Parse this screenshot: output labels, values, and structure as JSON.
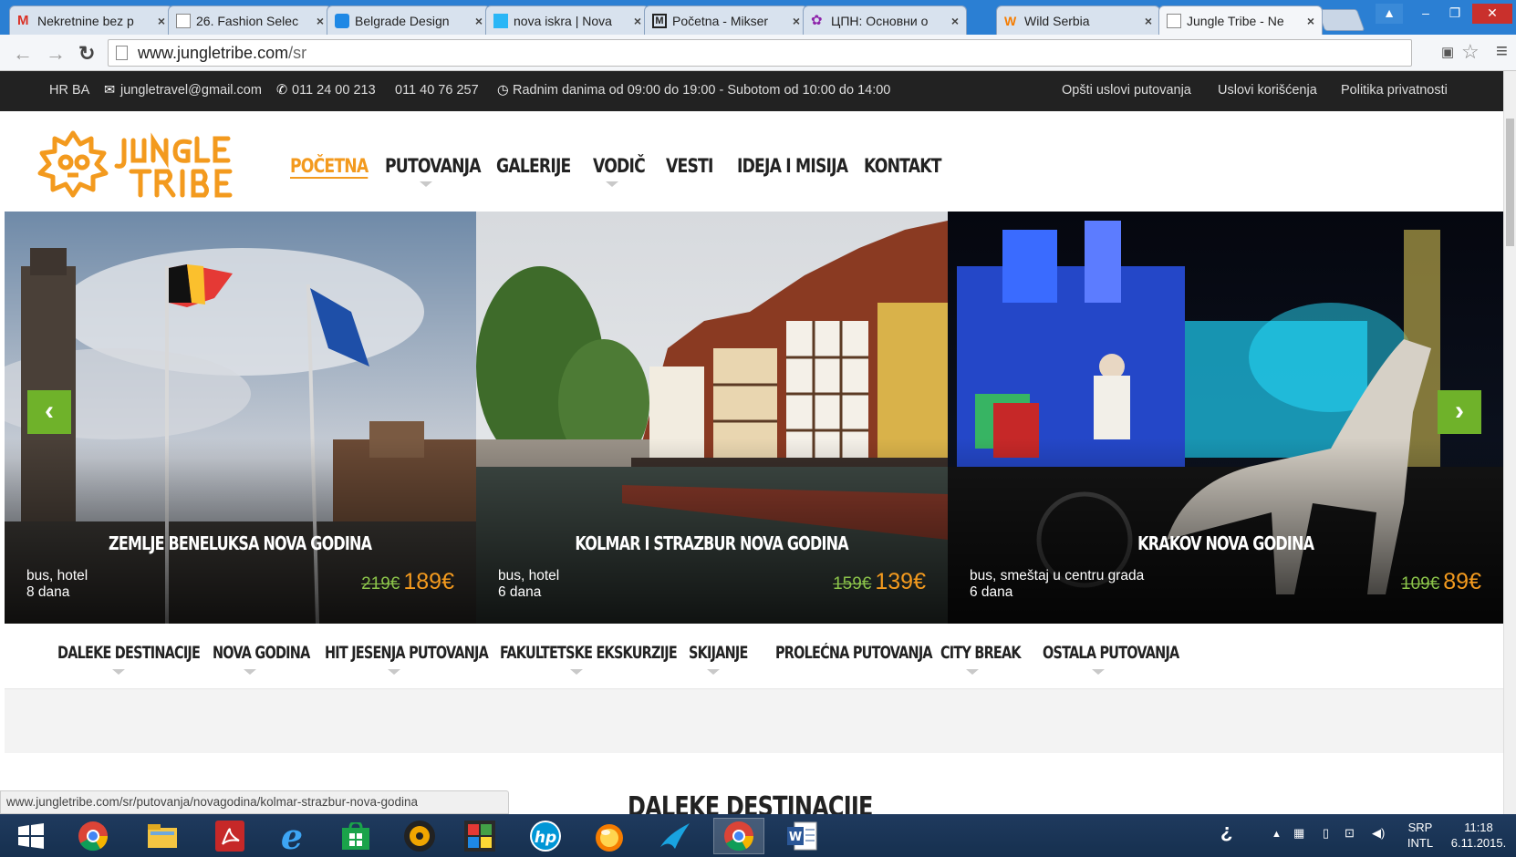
{
  "browser": {
    "tabs": [
      {
        "label": "Nekretnine bez p",
        "icon": "gmail-icon",
        "color": "#d93025"
      },
      {
        "label": "26. Fashion Selec",
        "icon": "page-icon",
        "color": "#888888"
      },
      {
        "label": "Belgrade Design",
        "icon": "bd-icon",
        "color": "#1e88e5"
      },
      {
        "label": "nova iskra | Nova",
        "icon": "iskra-icon",
        "color": "#29b6f6"
      },
      {
        "label": "Početna - Mikser",
        "icon": "mikser-icon",
        "color": "#222222"
      },
      {
        "label": "ЦПН: Основни о",
        "icon": "cpn-icon",
        "color": "#8e24aa"
      },
      {
        "label": "Wild Serbia",
        "icon": "wild-icon",
        "color": "#f57c00"
      },
      {
        "label": "Jungle Tribe - Ne",
        "icon": "page-icon",
        "color": "#888888"
      }
    ],
    "url_domain": "www.jungletribe.com",
    "url_path": "/sr",
    "status_url": "www.jungletribe.com/sr/putovanja/novagodina/kolmar-strazbur-nova-godina"
  },
  "topbar": {
    "languages": "HR BA",
    "email": "jungletravel@gmail.com",
    "phone1": "011 24 00 213",
    "phone2": "011 40 76 257",
    "hours": "Radnim danima od 09:00 do 19:00 - Subotom od 10:00 do 14:00",
    "links": [
      "Opšti uslovi putovanja",
      "Uslovi korišćenja",
      "Politika privatnosti"
    ]
  },
  "nav": {
    "items": [
      "POČETNA",
      "PUTOVANJA",
      "GALERIJE",
      "VODIČ",
      "VESTI",
      "IDEJA I MISIJA",
      "KONTAKT"
    ],
    "active": "POČETNA",
    "accent": "#f39a1e"
  },
  "slides": [
    {
      "title": "ZEMLJE BENELUKSA NOVA GODINA",
      "info1": "bus, hotel",
      "info2": "8 dana",
      "old_price": "219€",
      "price": "189€"
    },
    {
      "title": "KOLMAR I STRAZBUR NOVA GODINA",
      "info1": "bus, hotel",
      "info2": "6 dana",
      "old_price": "159€",
      "price": "139€"
    },
    {
      "title": "KRAKOV NOVA GODINA",
      "info1": "bus, smeštaj u centru grada",
      "info2": "6 dana",
      "old_price": "109€",
      "price": "89€"
    }
  ],
  "categories": [
    "DALEKE DESTINACIJE",
    "NOVA GODINA",
    "HIT JESENJA PUTOVANJA",
    "FAKULTETSKE EKSKURZIJE",
    "SKIJANJE",
    "PROLEĆNA PUTOVANJA",
    "CITY BREAK",
    "OSTALA PUTOVANJA"
  ],
  "section_title": "DALEKE DESTINACIJE",
  "taskbar": {
    "language": "SRP",
    "layout": "INTL",
    "time": "11:18",
    "date": "6.11.2015."
  }
}
